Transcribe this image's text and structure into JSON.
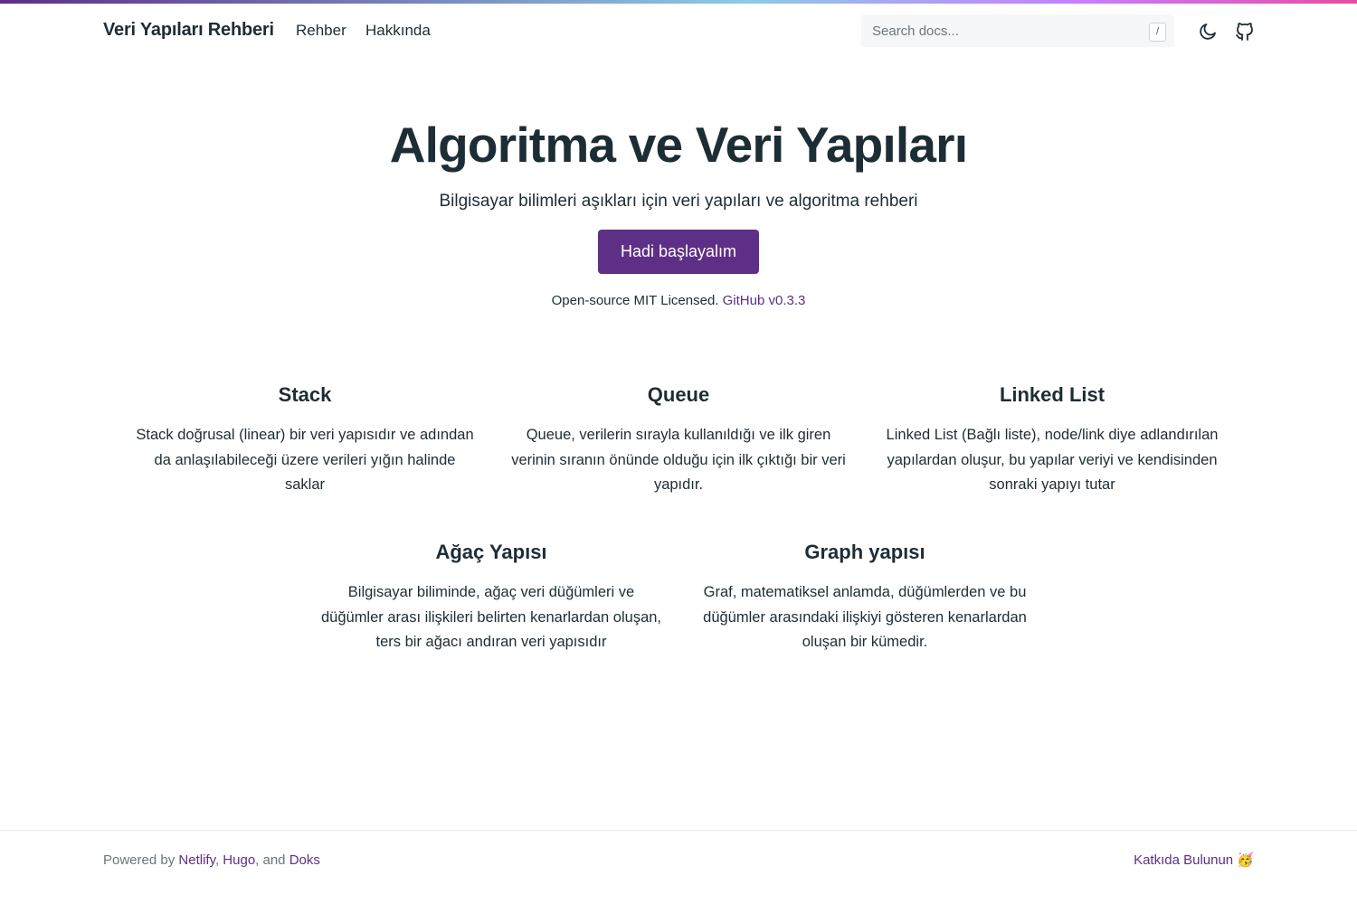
{
  "header": {
    "brand": "Veri Yapıları Rehberi",
    "nav": [
      {
        "label": "Rehber"
      },
      {
        "label": "Hakkında"
      }
    ],
    "search": {
      "placeholder": "Search docs...",
      "shortcut": "/"
    },
    "icons": [
      "moon-icon",
      "github-icon"
    ]
  },
  "hero": {
    "title": "Algoritma ve Veri Yapıları",
    "lead": "Bilgisayar bilimleri aşıkları için veri yapıları ve algoritma rehberi",
    "cta": "Hadi başlayalım",
    "license_text": "Open-source MIT Licensed.",
    "license_link": "GitHub v0.3.3"
  },
  "features": [
    {
      "title": "Stack",
      "text": "Stack doğrusal (linear) bir veri yapısıdır ve adından da anlaşılabileceği üzere verileri yığın halinde saklar"
    },
    {
      "title": "Queue",
      "text": "Queue, verilerin sırayla kullanıldığı ve ilk giren verinin sıranın önünde olduğu için ilk çıktığı bir veri yapıdır."
    },
    {
      "title": "Linked List",
      "text": "Linked List (Bağlı liste), node/link diye adlandırılan yapılardan oluşur, bu yapılar veriyi ve kendisinden sonraki yapıyı tutar"
    },
    {
      "title": "Ağaç Yapısı",
      "text": "Bilgisayar biliminde, ağaç veri düğümleri ve düğümler arası ilişkileri belirten kenarlardan oluşan, ters bir ağacı andıran veri yapısıdır"
    },
    {
      "title": "Graph yapısı",
      "text": "Graf, matematiksel anlamda, düğümlerden ve bu düğümler arasındaki ilişkiyi gösteren kenarlardan oluşan bir kümedir."
    }
  ],
  "footer": {
    "powered_prefix": "Powered by",
    "links": [
      "Netlify",
      "Hugo",
      "Doks"
    ],
    "sep1": ",",
    "sep2": ", and",
    "contribute": "Katkıda Bulunun 🥳"
  },
  "colors": {
    "accent": "#5d2f86",
    "text": "#1d2d35",
    "muted": "#6c757d"
  }
}
